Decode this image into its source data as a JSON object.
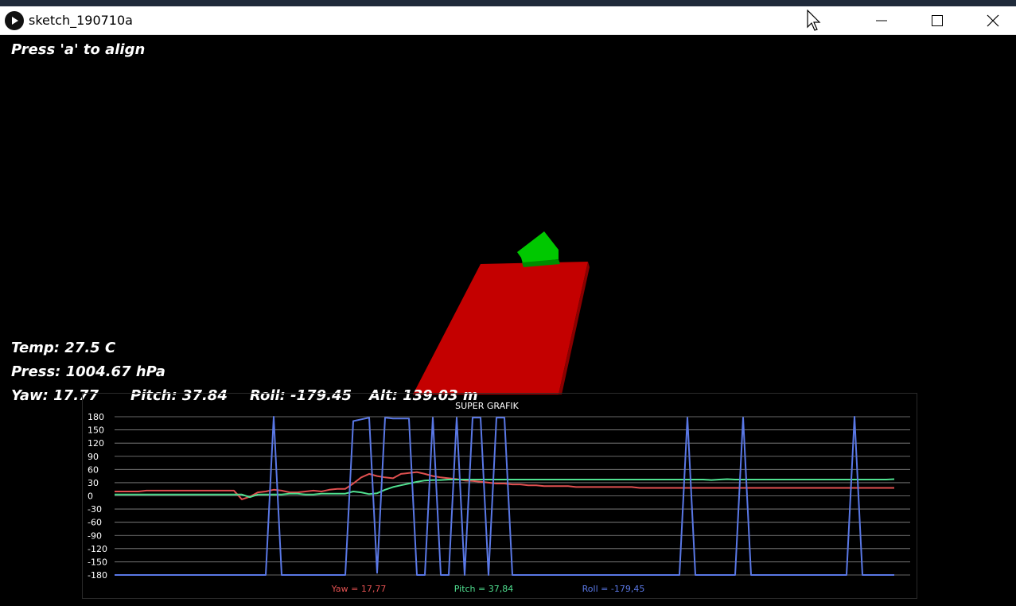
{
  "window": {
    "title": "sketch_190710a",
    "icon": "processing-play-icon",
    "controls": [
      "minimize-icon",
      "maximize-icon",
      "close-icon"
    ]
  },
  "hud": {
    "instruction": "Press 'a' to align",
    "temp": "Temp: 27.5 C",
    "press": "Press: 1004.67 hPa",
    "yaw": "Yaw: 17.77",
    "pitch": "Pitch: 37.84",
    "roll": "Roll: -179.45",
    "alt": "Alt: 139.03 m"
  },
  "colors": {
    "plate": "#c40000",
    "arrow": "#00c800",
    "yaw": "#e05050",
    "pitch": "#50e090",
    "roll": "#5a78e6",
    "grid": "#8a8a8a"
  },
  "chart_data": {
    "type": "line",
    "title": "SUPER GRAFIK",
    "ylim": [
      -180,
      180
    ],
    "yticks": [
      180,
      150,
      120,
      90,
      60,
      30,
      0,
      -30,
      -60,
      -90,
      -120,
      -150,
      -180
    ],
    "grid": true,
    "legend_position": "bottom-center",
    "series": [
      {
        "name": "Yaw = 17,77",
        "color": "#e05050",
        "values": [
          10,
          10,
          10,
          10,
          12,
          12,
          12,
          12,
          12,
          12,
          12,
          12,
          12,
          12,
          12,
          12,
          -8,
          -2,
          8,
          10,
          14,
          12,
          8,
          8,
          10,
          12,
          10,
          14,
          16,
          16,
          28,
          42,
          50,
          45,
          42,
          40,
          50,
          52,
          54,
          50,
          45,
          42,
          40,
          38,
          35,
          34,
          32,
          30,
          28,
          28,
          26,
          26,
          24,
          24,
          22,
          22,
          22,
          22,
          20,
          20,
          20,
          20,
          20,
          20,
          20,
          20,
          18,
          18,
          18,
          18,
          18,
          18,
          18,
          18,
          18,
          18,
          18,
          18,
          18,
          18,
          18,
          18,
          18,
          18,
          18,
          18,
          18,
          18,
          18,
          18,
          18,
          18,
          18,
          18,
          18,
          18,
          18,
          18,
          18
        ]
      },
      {
        "name": "Pitch = 37,84",
        "color": "#50e090",
        "values": [
          3,
          3,
          3,
          3,
          3,
          3,
          3,
          3,
          3,
          3,
          3,
          3,
          3,
          3,
          3,
          3,
          3,
          -3,
          3,
          3,
          3,
          3,
          5,
          5,
          3,
          3,
          5,
          5,
          5,
          5,
          10,
          8,
          4,
          6,
          14,
          20,
          24,
          28,
          32,
          35,
          36,
          36,
          37,
          37,
          37,
          37,
          37,
          37,
          37,
          37,
          37,
          37,
          37,
          37,
          37,
          37,
          37,
          37,
          37,
          37,
          37,
          37,
          37,
          37,
          37,
          37,
          37,
          37,
          37,
          37,
          37,
          37,
          37,
          37,
          37,
          36,
          37,
          38,
          37,
          37,
          37,
          37,
          37,
          37,
          37,
          37,
          37,
          37,
          37,
          37,
          37,
          37,
          37,
          37,
          37,
          37,
          37,
          37,
          38
        ]
      },
      {
        "name": "Roll = -179,45",
        "color": "#5a78e6",
        "values": [
          -180,
          -180,
          -180,
          -180,
          -180,
          -180,
          -180,
          -180,
          -180,
          -180,
          -180,
          -180,
          -180,
          -180,
          -180,
          -180,
          -180,
          -180,
          -180,
          -180,
          180,
          -180,
          -180,
          -180,
          -180,
          -180,
          -180,
          -180,
          -180,
          -180,
          170,
          174,
          178,
          -175,
          178,
          176,
          176,
          176,
          -180,
          -180,
          178,
          -180,
          -180,
          178,
          -180,
          178,
          178,
          -180,
          178,
          178,
          -180,
          -180,
          -180,
          -180,
          -180,
          -180,
          -180,
          -180,
          -180,
          -180,
          -180,
          -180,
          -180,
          -180,
          -180,
          -180,
          -180,
          -180,
          -180,
          -180,
          -180,
          -180,
          178,
          -180,
          -180,
          -180,
          -180,
          -180,
          -180,
          178,
          -180,
          -180,
          -180,
          -180,
          -180,
          -180,
          -180,
          -180,
          -180,
          -180,
          -180,
          -180,
          -180,
          180,
          -180,
          -180,
          -180,
          -180,
          -180
        ]
      }
    ]
  }
}
